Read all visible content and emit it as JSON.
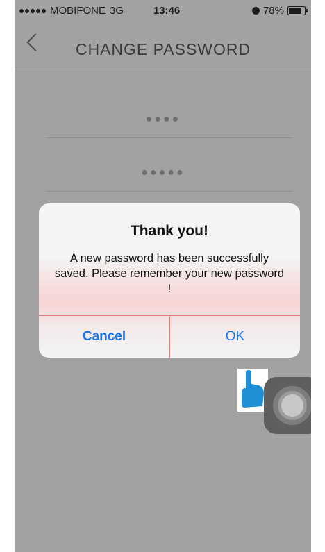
{
  "status_bar": {
    "carrier": "MOBIFONE",
    "network": "3G",
    "time": "13:46",
    "battery_label": "78%",
    "battery_level": 0.78
  },
  "navbar": {
    "title": "CHANGE PASSWORD",
    "back_icon": "chevron-left-icon"
  },
  "form": {
    "fields": [
      {
        "masked_value": "●●●●"
      },
      {
        "masked_value": "●●●●●"
      }
    ]
  },
  "dialog": {
    "title": "Thank you!",
    "message": "A new password has been successfully saved. Please remember your new password !",
    "cancel_label": "Cancel",
    "ok_label": "OK"
  },
  "overlays": {
    "pointer_icon": "hand-pointer-icon",
    "assistive_touch_icon": "assistive-touch-icon"
  },
  "colors": {
    "accent": "#1a73e8",
    "dim_background": "#a2a2a2",
    "pointer": "#1f8fd6"
  }
}
